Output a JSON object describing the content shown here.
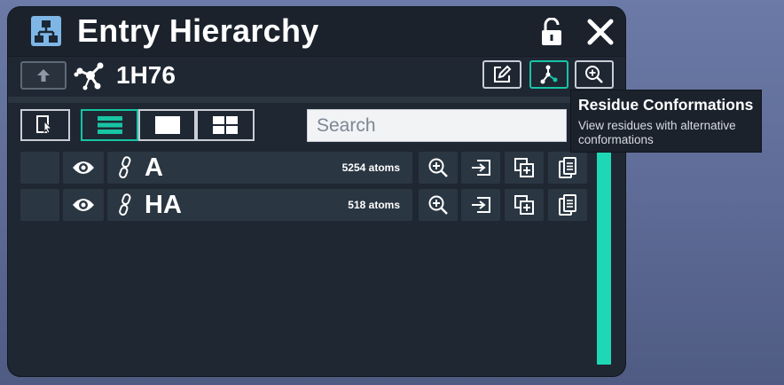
{
  "window": {
    "title": "Entry Hierarchy",
    "app_icon": "hierarchy-icon",
    "lock_icon": "unlock-icon",
    "close_icon": "close-icon"
  },
  "entry": {
    "id": "1H76",
    "icon": "molecule-icon",
    "up_button_icon": "arrow-up-icon"
  },
  "toolbar": {
    "edit_icon": "edit-icon",
    "residue_conformations_icon": "conformations-icon",
    "zoom_icon": "zoom-icon"
  },
  "view_controls": {
    "select_mode_icon": "select-pointer-icon",
    "list_view_icon": "list-view-icon",
    "single_view_icon": "single-view-icon",
    "grid_view_icon": "grid-view-icon",
    "active_view": "list"
  },
  "search": {
    "placeholder": "Search",
    "value": ""
  },
  "chains": [
    {
      "name": "A",
      "atoms": "5254 atoms"
    },
    {
      "name": "HA",
      "atoms": "518 atoms"
    }
  ],
  "tooltip": {
    "title": "Residue Conformations",
    "description": "View residues with alternative conformations"
  },
  "colors": {
    "accent": "#18c4a4",
    "panel_bg": "#1f2733",
    "row_bg": "#2a3642",
    "scrollbar": "#1ed7b5"
  }
}
